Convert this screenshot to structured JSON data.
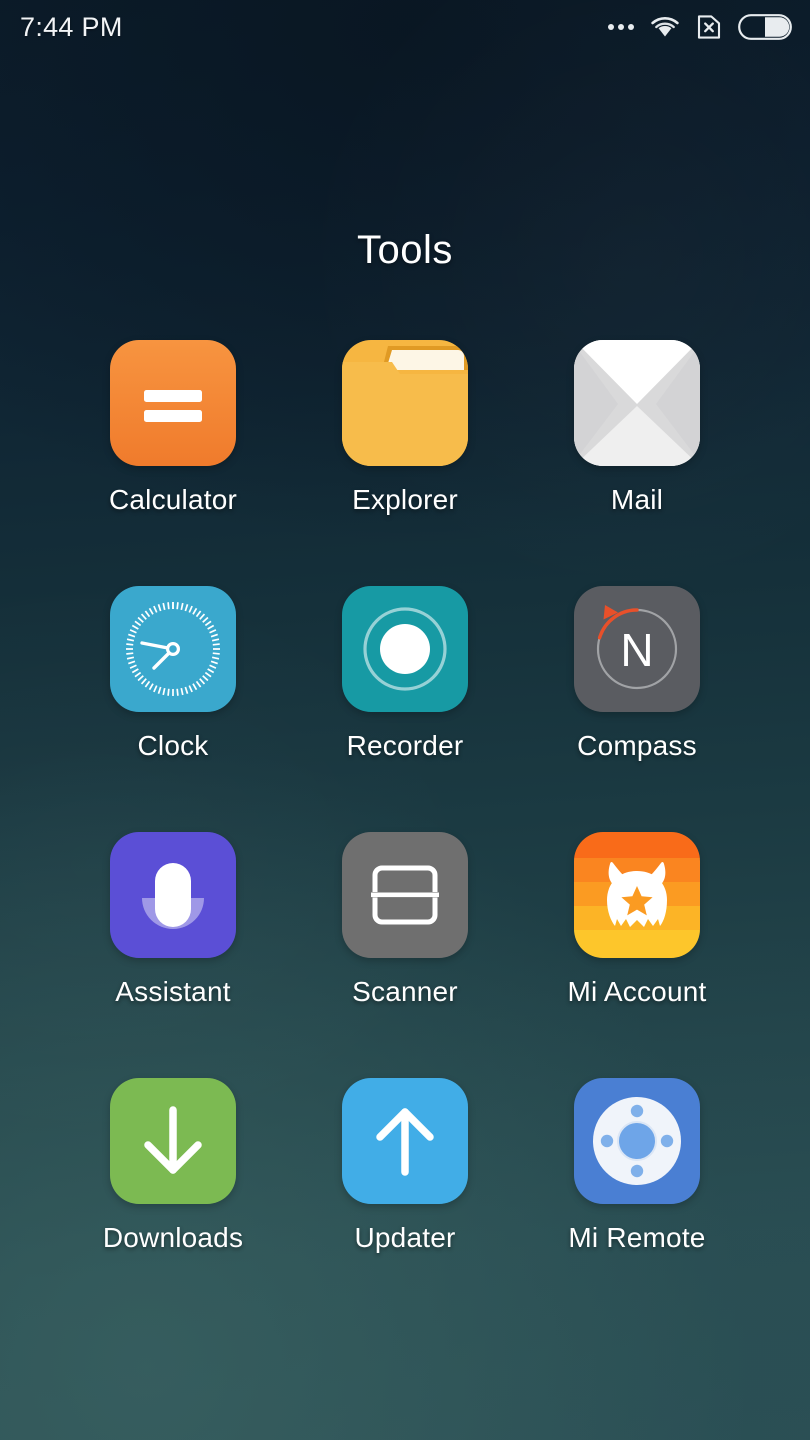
{
  "status_bar": {
    "time": "7:44 PM",
    "icons": [
      {
        "name": "more-dots-icon",
        "label": "more"
      },
      {
        "name": "wifi-icon",
        "label": "Wi-Fi connected"
      },
      {
        "name": "sim-card-x-icon",
        "label": "No SIM card"
      },
      {
        "name": "battery-icon",
        "label": "Battery"
      }
    ]
  },
  "folder": {
    "title": "Tools"
  },
  "theme": {
    "wallpaper_top": "#0c1d2b",
    "wallpaper_bottom": "#2d5055",
    "label_color": "#ffffff",
    "status_text_color": "#f2f4f6"
  },
  "apps": [
    {
      "label": "Calculator",
      "icon": "calculator-icon",
      "color": "#f4873a"
    },
    {
      "label": "Explorer",
      "icon": "folder-icon",
      "color": "#f6b641"
    },
    {
      "label": "Mail",
      "icon": "envelope-icon",
      "color": "#f2f2f2"
    },
    {
      "label": "Clock",
      "icon": "clock-icon",
      "color": "#3aa8cd"
    },
    {
      "label": "Recorder",
      "icon": "record-icon",
      "color": "#179aa4"
    },
    {
      "label": "Compass",
      "icon": "compass-icon",
      "color": "#5a5c61"
    },
    {
      "label": "Assistant",
      "icon": "microphone-icon",
      "color": "#5b4fd6"
    },
    {
      "label": "Scanner",
      "icon": "scanner-icon",
      "color": "#6f6f6f"
    },
    {
      "label": "Mi Account",
      "icon": "mi-bunny-icon",
      "color": "#f97a22"
    },
    {
      "label": "Downloads",
      "icon": "arrow-down-icon",
      "color": "#7cba52"
    },
    {
      "label": "Updater",
      "icon": "arrow-up-icon",
      "color": "#41ade7"
    },
    {
      "label": "Mi Remote",
      "icon": "remote-icon",
      "color": "#4a7fd3"
    }
  ]
}
